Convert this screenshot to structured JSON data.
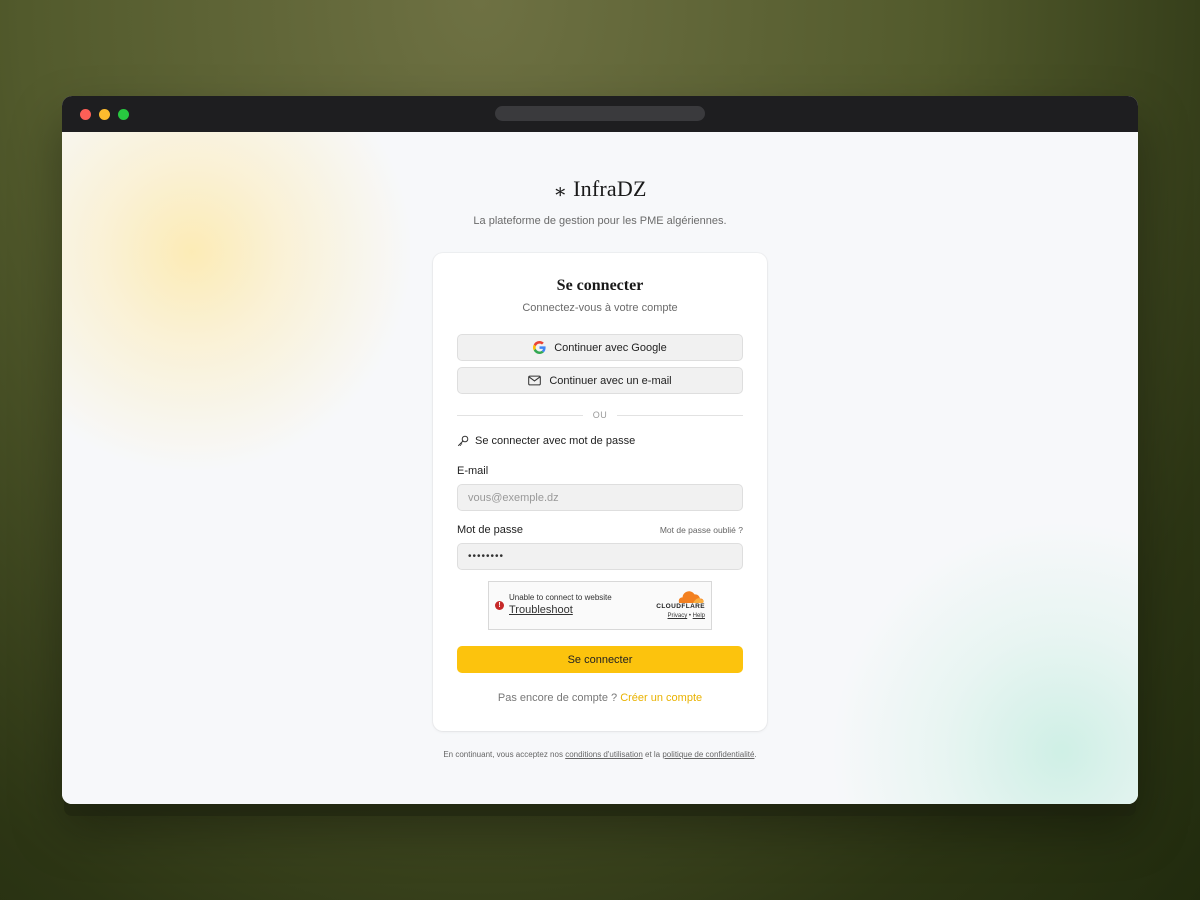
{
  "brand": {
    "name": "InfraDZ",
    "symbol": "∗",
    "tagline": "La plateforme de gestion pour les PME algériennes."
  },
  "card": {
    "title": "Se connecter",
    "subtitle": "Connectez-vous à votre compte",
    "google_button": "Continuer avec Google",
    "email_button": "Continuer avec un e-mail",
    "divider": "OU",
    "password_heading": "Se connecter avec mot de passe",
    "email_label": "E-mail",
    "email_placeholder": "vous@exemple.dz",
    "password_label": "Mot de passe",
    "forgot_link": "Mot de passe oublié ?",
    "password_value": "••••••••",
    "submit": "Se connecter",
    "signup_prompt": "Pas encore de compte ?",
    "signup_link": "Créer un compte"
  },
  "captcha": {
    "message": "Unable to connect to website",
    "troubleshoot": "Troubleshoot",
    "provider": "CLOUDFLARE",
    "privacy": "Privacy",
    "separator": "•",
    "help": "Help"
  },
  "footer": {
    "prefix": "En continuant, vous acceptez nos",
    "terms": "conditions d'utilisation",
    "middle": "et la",
    "privacy": "politique de confidentialité",
    "suffix": "."
  },
  "colors": {
    "accent": "#fcc30d",
    "accent_link": "#e9b200",
    "error": "#c62828",
    "cloudflare": "#f38020"
  }
}
